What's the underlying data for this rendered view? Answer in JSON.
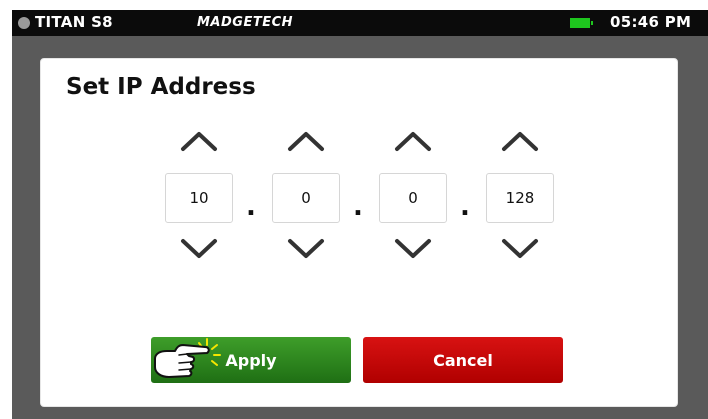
{
  "status_bar": {
    "device_name": "TITAN S8",
    "brand": "MADGETECH",
    "time": "05:46 PM",
    "battery_icon": "battery-full-icon",
    "battery_color": "#1ec51e"
  },
  "dialog": {
    "title": "Set IP Address",
    "octets": [
      "10",
      "0",
      "0",
      "128"
    ],
    "separator": ".",
    "apply_label": "Apply",
    "cancel_label": "Cancel",
    "apply_color": "#2e8a1f",
    "cancel_color": "#c80808",
    "pointer_icon": "pointing-hand-icon"
  }
}
